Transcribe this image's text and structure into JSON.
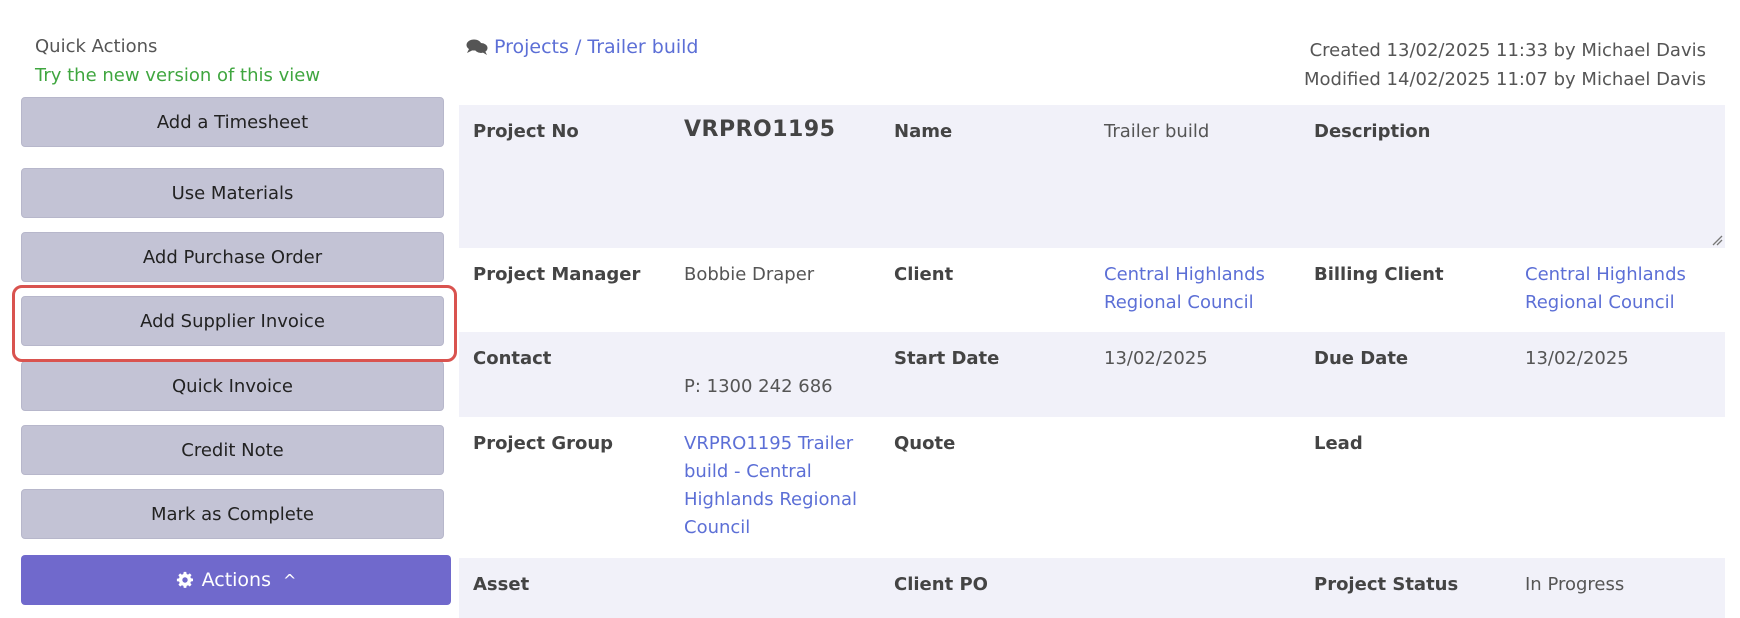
{
  "quick_actions": {
    "title": "Quick Actions",
    "new_version_link": "Try the new version of this view",
    "buttons": [
      "Add a Timesheet",
      "Use Materials",
      "Add Purchase Order",
      "Add Supplier Invoice",
      "Quick Invoice",
      "Credit Note",
      "Mark as Complete"
    ],
    "actions_label": "Actions",
    "actions_caret": "^"
  },
  "header": {
    "breadcrumb": "Projects / Trailer build",
    "created": "Created 13/02/2025 11:33 by Michael Davis",
    "modified": "Modified 14/02/2025 11:07 by Michael Davis"
  },
  "fields": {
    "project_no_label": "Project No",
    "project_no": "VRPRO1195",
    "name_label": "Name",
    "name": "Trailer build",
    "description_label": "Description",
    "description": "",
    "project_manager_label": "Project Manager",
    "project_manager": "Bobbie Draper",
    "client_label": "Client",
    "client": "Central Highlands Regional Council",
    "billing_client_label": "Billing Client",
    "billing_client": "Central Highlands Regional Council",
    "contact_label": "Contact",
    "contact_phone": "P: 1300 242 686",
    "start_date_label": "Start Date",
    "start_date": "13/02/2025",
    "due_date_label": "Due Date",
    "due_date": "13/02/2025",
    "project_group_label": "Project Group",
    "project_group": "VRPRO1195 Trailer build - Central Highlands Regional Council",
    "quote_label": "Quote",
    "lead_label": "Lead",
    "asset_label": "Asset",
    "client_po_label": "Client PO",
    "project_status_label": "Project Status",
    "project_status": "In Progress"
  },
  "colors": {
    "button_bg": "#c3c3d5",
    "actions_bg": "#7069cc",
    "link": "#5c6fd6",
    "highlight": "#d9534f",
    "green_link": "#3fa63f",
    "row_shade": "#f1f1f9"
  },
  "icons": [
    "chat-icon",
    "gear-icon",
    "chevron-up-icon",
    "resize-grip-icon"
  ]
}
